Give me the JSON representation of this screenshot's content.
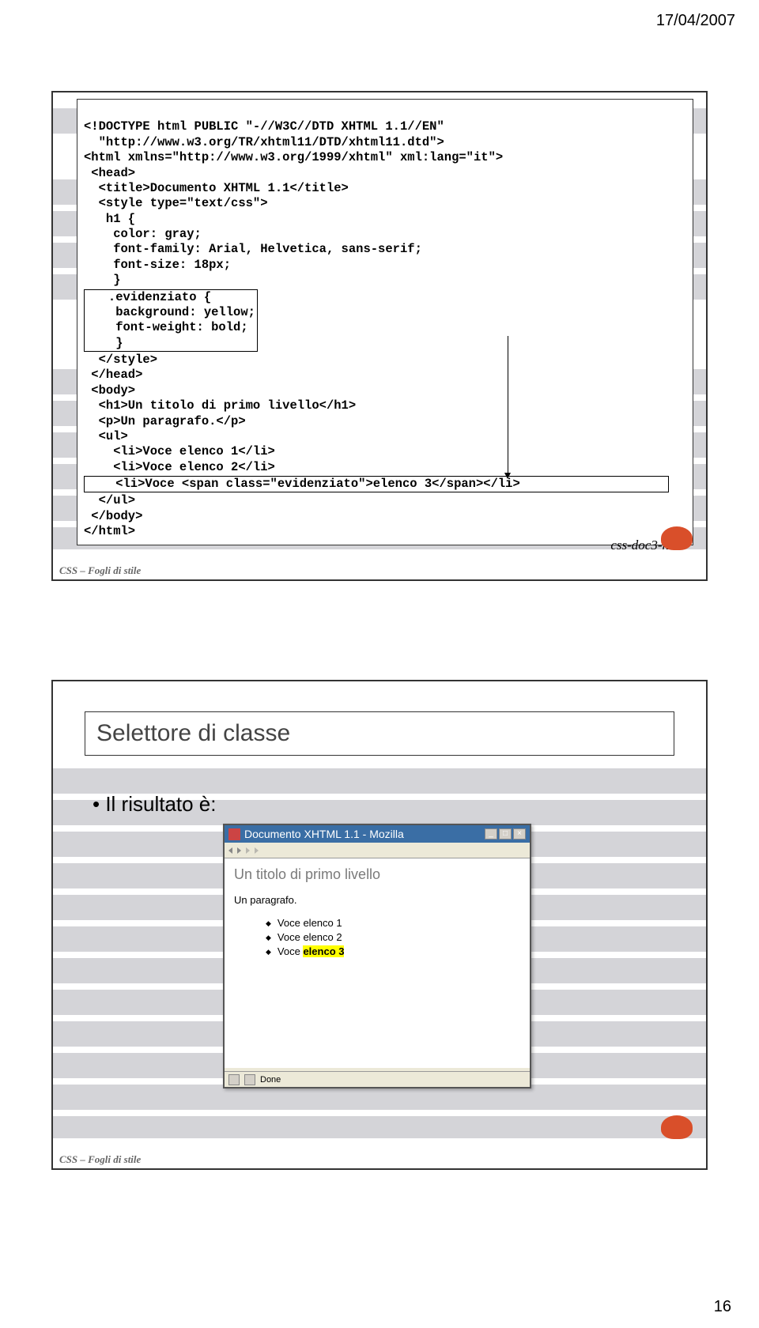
{
  "page_date": "17/04/2007",
  "page_number": "16",
  "footer_label": "CSS – Fogli di stile",
  "slide1": {
    "file_label": "css-doc3-htm",
    "code": {
      "l1": "<!DOCTYPE html PUBLIC \"-//W3C//DTD XHTML 1.1//EN\"",
      "l2": "  \"http://www.w3.org/TR/xhtml11/DTD/xhtml11.dtd\">",
      "l3": "<html xmlns=\"http://www.w3.org/1999/xhtml\" xml:lang=\"it\">",
      "l4": " <head>",
      "l5": "  <title>Documento XHTML 1.1</title>",
      "l6": "  <style type=\"text/css\">",
      "l7": "   h1 {",
      "l8": "    color: gray;",
      "l9": "    font-family: Arial, Helvetica, sans-serif;",
      "l10": "    font-size: 18px;",
      "l11": "    }",
      "hl1a": "   .evidenziato {",
      "hl1b": "    background: yellow;",
      "hl1c": "    font-weight: bold;",
      "hl1d": "    }",
      "l12": "  </style>",
      "l13": " </head>",
      "l14": " <body>",
      "l15": "  <h1>Un titolo di primo livello</h1>",
      "l16": "  <p>Un paragrafo.</p>",
      "l17": "  <ul>",
      "l18": "    <li>Voce elenco 1</li>",
      "l19": "    <li>Voce elenco 2</li>",
      "hl2": "    <li>Voce <span class=\"evidenziato\">elenco 3</span></li>",
      "l20": "  </ul>",
      "l21": " </body>",
      "l22": "</html>"
    }
  },
  "slide2": {
    "title": "Selettore di classe",
    "bullet": "• Il risultato è:",
    "window": {
      "title": "Documento XHTML 1.1 - Mozilla",
      "h1": "Un titolo di primo livello",
      "para": "Un paragrafo.",
      "li1": "Voce elenco 1",
      "li2": "Voce elenco 2",
      "li3a": "Voce ",
      "li3b": "elenco 3",
      "status": "Done"
    }
  }
}
